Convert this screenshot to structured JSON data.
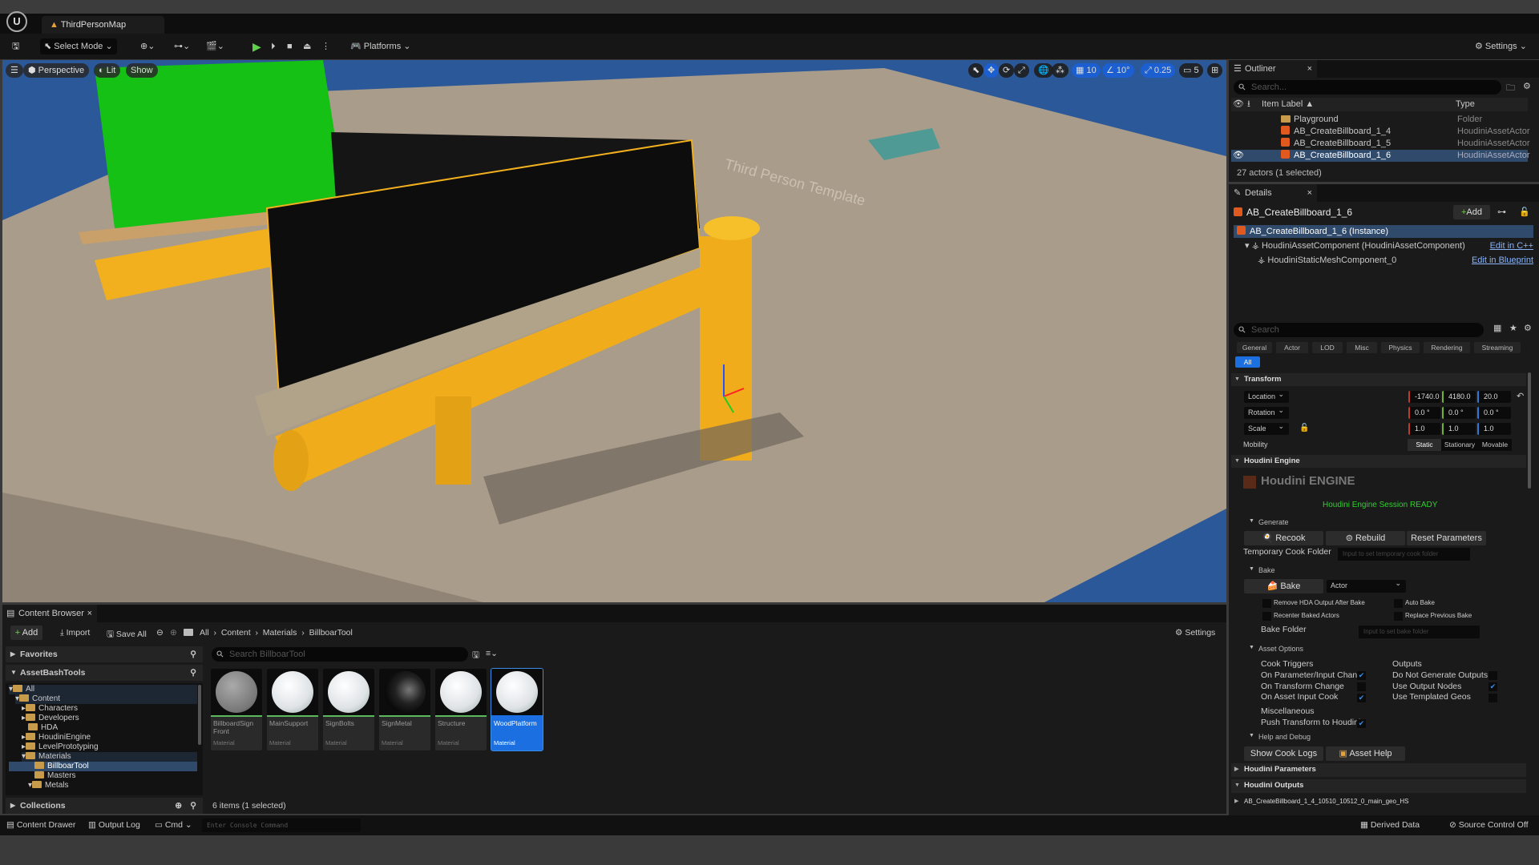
{
  "title_bar": {
    "map_tab": "ThirdPersonMap"
  },
  "toolbar": {
    "select_mode": "Select Mode",
    "platforms": "Platforms",
    "settings": "Settings"
  },
  "viewport": {
    "perspective": "Perspective",
    "lit": "Lit",
    "show": "Show",
    "grid_snap": "10",
    "rotation_snap": "10°",
    "scale_snap": "0.25",
    "camera_speed": "5",
    "scene_text": "Third Person Template"
  },
  "outliner": {
    "tab": "Outliner",
    "search_placeholder": "Search...",
    "col_label": "Item Label ▲",
    "col_type": "Type",
    "rows": [
      {
        "label": "Playground",
        "type": "Folder"
      },
      {
        "label": "AB_CreateBillboard_1_4",
        "type": "HoudiniAssetActor"
      },
      {
        "label": "AB_CreateBillboard_1_5",
        "type": "HoudiniAssetActor"
      },
      {
        "label": "AB_CreateBillboard_1_6",
        "type": "HoudiniAssetActor"
      }
    ],
    "status": "27 actors (1 selected)"
  },
  "details": {
    "tab": "Details",
    "actor_name": "AB_CreateBillboard_1_6",
    "add": "Add",
    "instance": "AB_CreateBillboard_1_6 (Instance)",
    "component1": "HoudiniAssetComponent (HoudiniAssetComponent)",
    "component1_link": "Edit in C++",
    "component2": "HoudiniStaticMeshComponent_0",
    "component2_link": "Edit in Blueprint",
    "search_placeholder": "Search",
    "filter_tabs": [
      "General",
      "Actor",
      "LOD",
      "Misc",
      "Physics",
      "Rendering",
      "Streaming",
      "All"
    ],
    "transform": {
      "header": "Transform",
      "location_label": "Location",
      "rotation_label": "Rotation",
      "scale_label": "Scale",
      "location": [
        "-1740.0",
        "4180.0",
        "20.0"
      ],
      "rotation": [
        "0.0 °",
        "0.0 °",
        "0.0 °"
      ],
      "scale": [
        "1.0",
        "1.0",
        "1.0"
      ],
      "mobility_label": "Mobility",
      "mobility": [
        "Static",
        "Stationary",
        "Movable"
      ],
      "mobility_selected": "Static"
    },
    "houdini": {
      "header": "Houdini Engine",
      "logo_text": "Houdini ENGINE",
      "session": "Houdini Engine Session READY",
      "session_color": "#2fd12f",
      "generate": "Generate",
      "recook": "Recook",
      "rebuild": "Rebuild",
      "reset": "Reset Parameters",
      "temp_folder_label": "Temporary Cook Folder",
      "temp_folder_placeholder": "Input to set temporary cook folder",
      "bake_section": "Bake",
      "bake_button": "Bake",
      "bake_type": "Actor",
      "remove_hda": "Remove HDA Output After Bake",
      "auto_bake": "Auto Bake",
      "recenter": "Recenter Baked Actors",
      "replace_prev": "Replace Previous Bake",
      "bake_folder_label": "Bake Folder",
      "bake_folder_placeholder": "Input to set bake folder",
      "asset_options": "Asset Options",
      "cook_triggers": "Cook Triggers",
      "on_param": "On Parameter/Input Chang",
      "on_param_checked": true,
      "on_transform": "On Transform Change",
      "on_transform_checked": false,
      "on_asset_input": "On Asset Input Cook",
      "on_asset_input_checked": true,
      "outputs": "Outputs",
      "no_gen": "Do Not Generate Outputs",
      "no_gen_checked": false,
      "use_output_nodes": "Use Output Nodes",
      "use_output_nodes_checked": true,
      "use_templated": "Use Templated Geos",
      "use_templated_checked": false,
      "misc": "Miscellaneous",
      "push_transform": "Push Transform to Houdini",
      "push_transform_checked": true,
      "help_debug": "Help and Debug",
      "show_logs": "Show Cook Logs",
      "asset_help": "Asset Help",
      "params_header": "Houdini Parameters",
      "outputs_header": "Houdini Outputs",
      "output_item": "AB_CreateBillboard_1_4_10510_10512_0_main_geo_HS"
    }
  },
  "content_browser": {
    "tab": "Content Browser",
    "add": "Add",
    "import": "Import",
    "save_all": "Save All",
    "settings": "Settings",
    "breadcrumb": [
      "All",
      "Content",
      "Materials",
      "BillboarTool"
    ],
    "favorites": "Favorites",
    "asset_root": "AssetBashTools",
    "collections": "Collections",
    "tree": [
      "All",
      "Content",
      "Characters",
      "Developers",
      "HDA",
      "HoudiniEngine",
      "LevelPrototyping",
      "Materials",
      "BillboarTool",
      "Masters",
      "Metals"
    ],
    "search_placeholder": "Search BillboarTool",
    "assets": [
      {
        "name": "BillboardSign Front",
        "type": "Material"
      },
      {
        "name": "MainSupport",
        "type": "Material"
      },
      {
        "name": "SignBolts",
        "type": "Material"
      },
      {
        "name": "SignMetal",
        "type": "Material"
      },
      {
        "name": "Structure",
        "type": "Material"
      },
      {
        "name": "WoodPlatform",
        "type": "Material"
      }
    ],
    "status": "6 items (1 selected)"
  },
  "status_bar": {
    "content_drawer": "Content Drawer",
    "output_log": "Output Log",
    "cmd": "Cmd",
    "console_placeholder": "Enter Console Command",
    "derived_data": "Derived Data",
    "source_control": "Source Control Off"
  }
}
